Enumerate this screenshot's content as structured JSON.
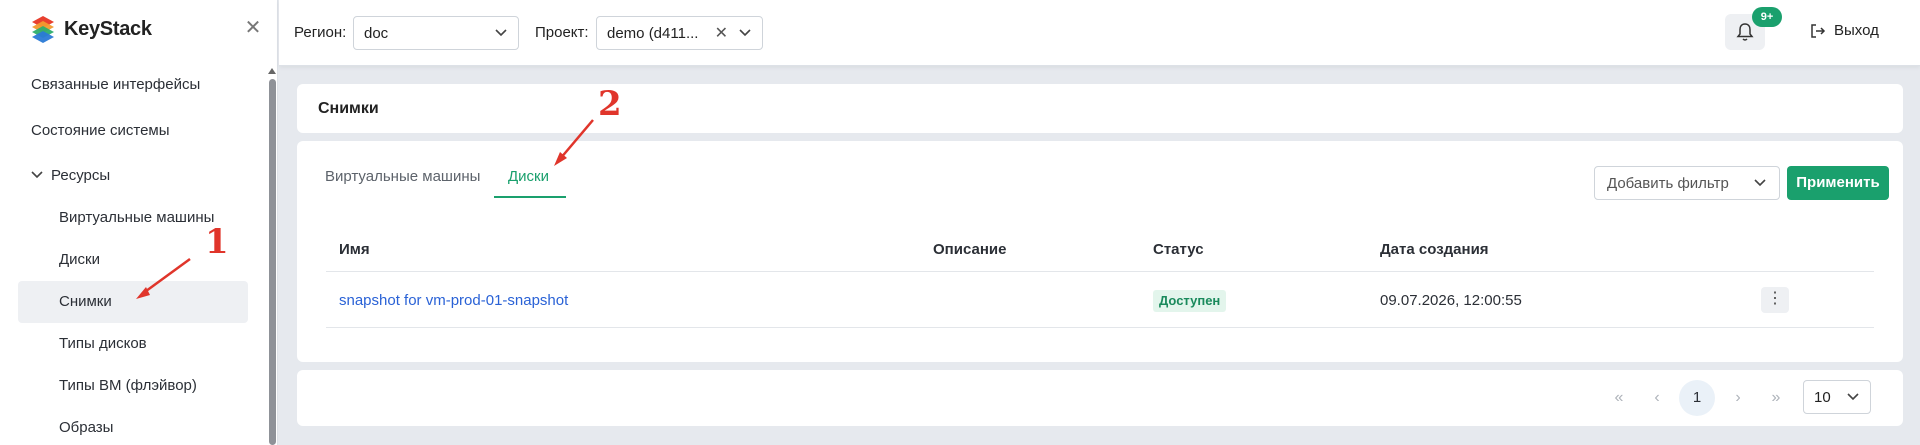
{
  "app": {
    "brand": "KeyStack"
  },
  "sidebar": {
    "items": [
      {
        "label": "Связанные интерфейсы"
      },
      {
        "label": "Состояние системы"
      },
      {
        "label": "Ресурсы"
      },
      {
        "label": "Виртуальные машины"
      },
      {
        "label": "Диски"
      },
      {
        "label": "Снимки"
      },
      {
        "label": "Типы дисков"
      },
      {
        "label": "Типы ВМ (флэйвор)"
      },
      {
        "label": "Образы"
      }
    ],
    "active": "Снимки"
  },
  "header": {
    "region_label": "Регион:",
    "region_value": "doc",
    "project_label": "Проект:",
    "project_value": "demo (d411...",
    "notifications_badge": "9+",
    "logout_label": "Выход"
  },
  "page": {
    "title": "Снимки",
    "tabs": [
      {
        "label": "Виртуальные машины",
        "active": false
      },
      {
        "label": "Диски",
        "active": true
      }
    ],
    "filter_placeholder": "Добавить фильтр",
    "apply_label": "Применить",
    "table": {
      "columns": [
        "Имя",
        "Описание",
        "Статус",
        "Дата создания"
      ],
      "rows": [
        {
          "name": "snapshot for vm-prod-01-snapshot",
          "description": "",
          "status": "Доступен",
          "created": "09.07.2026, 12:00:55"
        }
      ]
    },
    "pagination": {
      "current_page": "1",
      "page_size": "10"
    }
  },
  "annotations": {
    "marker_1": "1",
    "marker_2": "2"
  },
  "colors": {
    "accent": "#1aa06d",
    "link": "#2a62d6",
    "annotation": "#e0352b"
  }
}
